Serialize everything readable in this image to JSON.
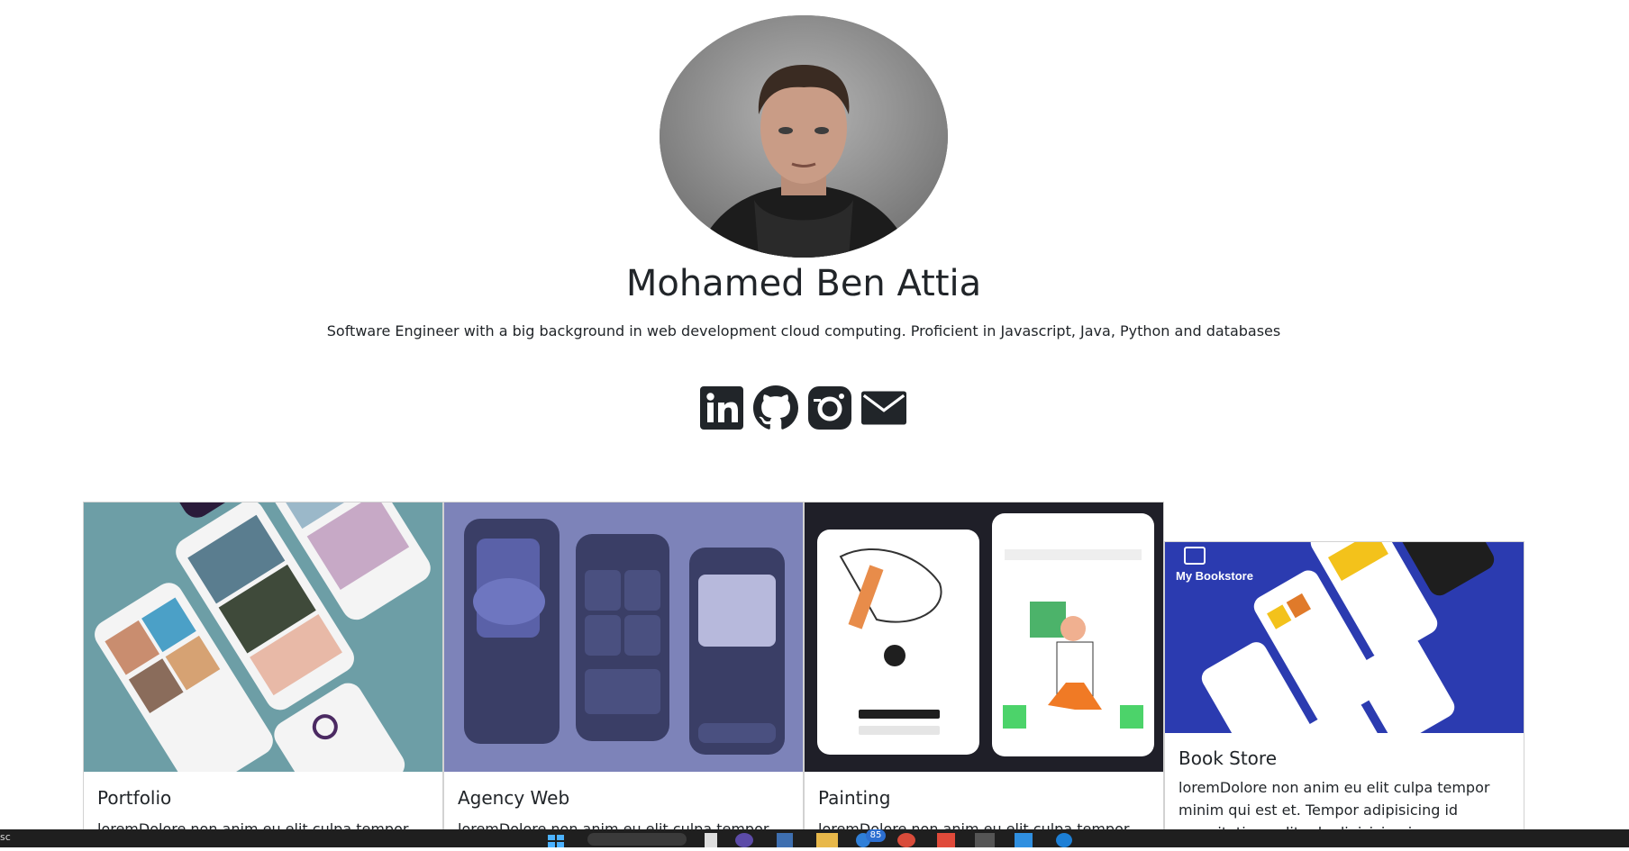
{
  "profile": {
    "name": "Mohamed Ben Attia",
    "bio": "Software Engineer with a big background in web development cloud computing. Proficient in Javascript, Java, Python and databases",
    "avatar_alt": "profile photo"
  },
  "socials": [
    {
      "name": "LinkedIn",
      "icon": "linkedin-icon"
    },
    {
      "name": "GitHub",
      "icon": "github-icon"
    },
    {
      "name": "Instagram",
      "icon": "instagram-icon"
    },
    {
      "name": "Email",
      "icon": "mail-icon"
    }
  ],
  "projects": [
    {
      "title": "Portfolio",
      "text": "loremDolore non anim eu elit culpa tempor minim",
      "thumb_color": "#6d9ea6"
    },
    {
      "title": "Agency Web",
      "text": "loremDolore non anim eu elit culpa tempor minim",
      "thumb_color": "#7d83b9"
    },
    {
      "title": "Painting",
      "text": "loremDolore non anim eu elit culpa tempor minim",
      "thumb_color": "#1f1f28"
    },
    {
      "title": "Book Store",
      "text": "loremDolore non anim eu elit culpa tempor minim qui est et. Tempor adipisicing id exercitation velit ad adipisicing irure voluptate duis sunt duis ut",
      "thumb_color": "#2b3bb0",
      "thumb_label": "My Bookstore"
    }
  ],
  "taskbar": {
    "left_text": "sc",
    "badge": "85"
  },
  "colors": {
    "text": "#212529",
    "taskbar": "#1f1f1f"
  }
}
